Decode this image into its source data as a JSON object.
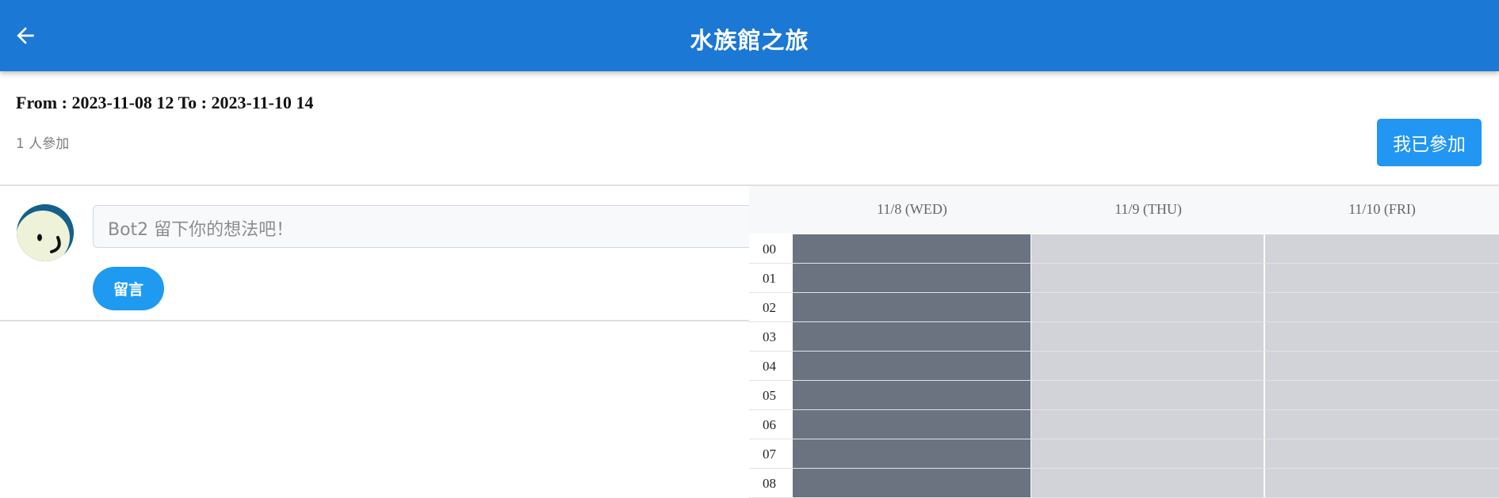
{
  "header": {
    "title": "水族館之旅",
    "back_icon": "arrow-left-icon",
    "bg_color": "#1b78d4"
  },
  "event": {
    "range_text": "From : 2023-11-08 12 To : 2023-11-10 14",
    "participants_text": "1 人參加",
    "join_button_label": "我已參加"
  },
  "comment": {
    "avatar_icon": "smiley-avatar-icon",
    "input_placeholder": "Bot2 留下你的想法吧！",
    "submit_label": "留言"
  },
  "schedule": {
    "days": [
      "11/8 (WED)",
      "11/9 (THU)",
      "11/10 (FRI)"
    ],
    "hours": [
      "00",
      "01",
      "02",
      "03",
      "04",
      "05",
      "06",
      "07",
      "08"
    ],
    "selected_day_index": 0,
    "selected_color": "#6b7280",
    "unselected_color": "#d1d3d9"
  }
}
